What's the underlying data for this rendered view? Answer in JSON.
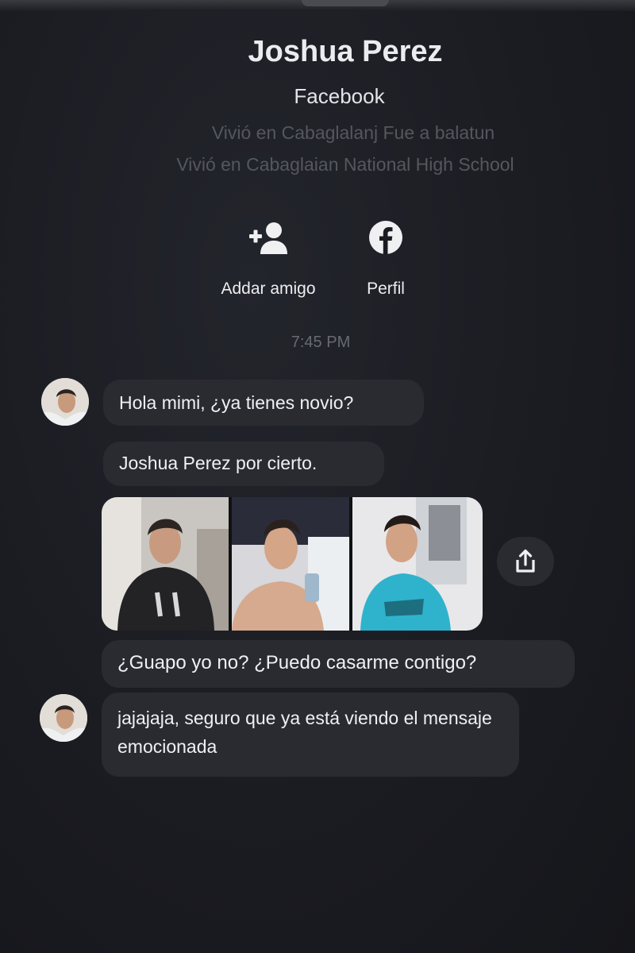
{
  "profile": {
    "name": "Joshua Perez",
    "source": "Facebook",
    "lived_1": "Vivió en Cabaglalanj Fue a balatun",
    "lived_2": "Vivió en Cabaglaian National High School"
  },
  "actions": {
    "add_friend_label": "Addar amigo",
    "add_friend_icon": "add-person-icon",
    "profile_label": "Perfil",
    "profile_icon": "facebook-icon"
  },
  "conversation": {
    "timestamp": "7:45 PM",
    "messages": [
      {
        "text": "Hola mimi, ¿ya tienes novio?"
      },
      {
        "text": "Joshua Perez por cierto."
      },
      {
        "text": "¿Guapo yo no? ¿Puedo casarme contigo?"
      },
      {
        "text": "jajajaja, seguro que ya está viendo el mensaje emocionada"
      }
    ],
    "share_icon": "share-icon"
  },
  "colors": {
    "background": "#1b1c22",
    "bubble": "#2a2b31",
    "text": "#f0f0f3",
    "muted": "#55575e"
  }
}
